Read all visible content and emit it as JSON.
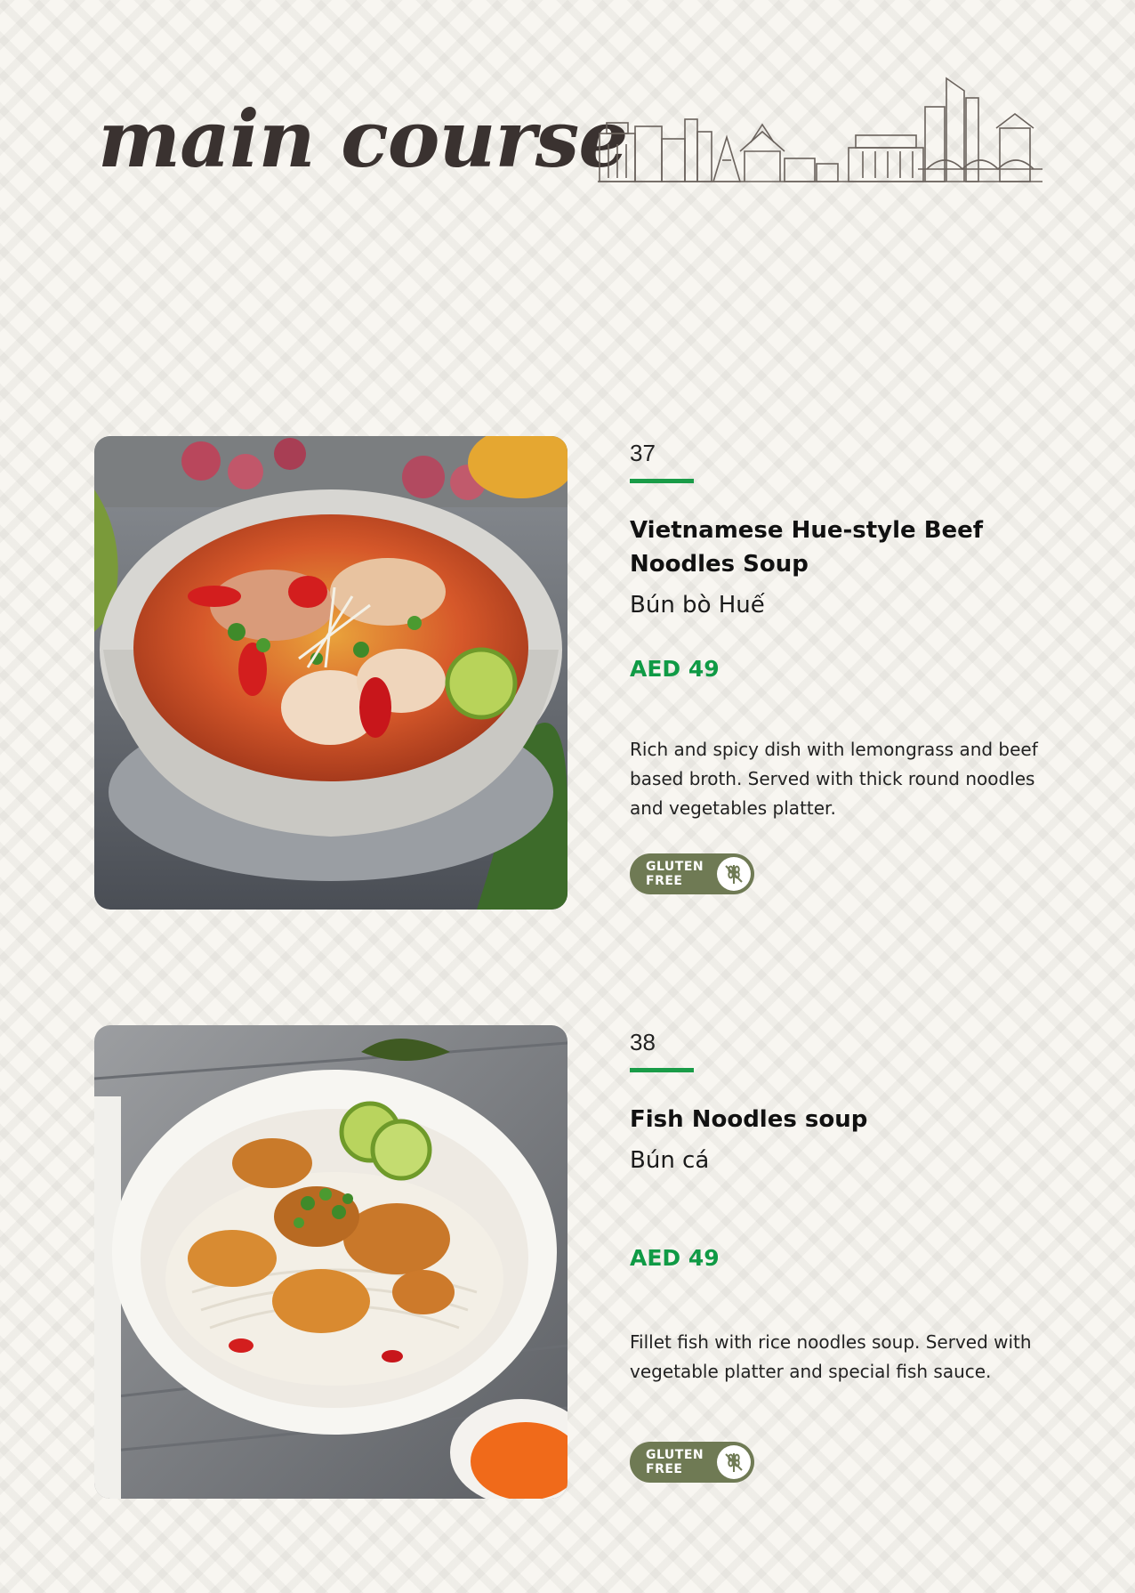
{
  "page": {
    "title": "main course"
  },
  "items": [
    {
      "number": "37",
      "name": "Vietnamese Hue-style Beef Noodles Soup",
      "local_name": "Bún bò Huế",
      "price": "AED 49",
      "description": "Rich and spicy dish with lemongrass and beef based broth. Served with thick round noodles and vegetables platter.",
      "badge": "GLUTEN\nFREE",
      "photo_icon": "beef-noodle-soup-photo"
    },
    {
      "number": "38",
      "name": "Fish Noodles soup",
      "local_name": "Bún cá",
      "price": "AED 49",
      "description": "Fillet fish with rice noodles soup. Served with vegetable platter and special fish sauce.",
      "badge": "GLUTEN\nFREE",
      "photo_icon": "fish-noodle-soup-photo"
    }
  ],
  "colors": {
    "accent_green": "#0f9a45",
    "badge_olive": "#6f7a54",
    "title_brown": "#3a3230",
    "background": "#f8f6f1"
  },
  "icons": {
    "skyline": "city-skyline-illustration",
    "gluten_free": "wheat-crossed-icon"
  }
}
